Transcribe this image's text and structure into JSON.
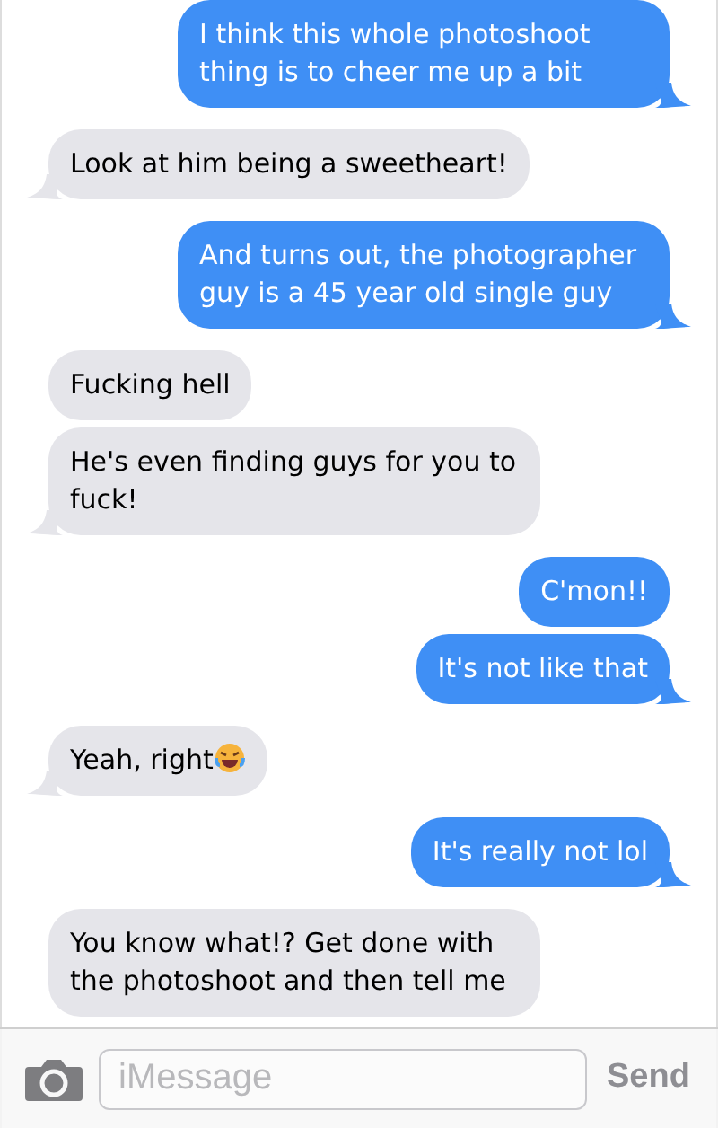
{
  "messages": [
    {
      "kind": "sent",
      "text": "I think this whole photoshoot thing is to cheer me up a bit",
      "tail": true
    },
    {
      "kind": "received",
      "text": "Look at him being a sweetheart!",
      "tail": true
    },
    {
      "kind": "sent",
      "text": "And turns out, the photographer guy is a 45 year old single guy",
      "tail": true
    },
    {
      "kind": "received",
      "text": "Fucking hell",
      "tail": false
    },
    {
      "kind": "received",
      "text": "He's even finding guys for you to fuck!",
      "tail": true
    },
    {
      "kind": "sent",
      "text": "C'mon!!",
      "tail": false
    },
    {
      "kind": "sent",
      "text": "It's not like that",
      "tail": true
    },
    {
      "kind": "received",
      "text": "Yeah, right",
      "emoji": true,
      "tail": true
    },
    {
      "kind": "sent",
      "text": "It's really not lol",
      "tail": true
    },
    {
      "kind": "received",
      "text": "You know what!? Get done with the photoshoot and then tell me",
      "tail": false
    }
  ],
  "composer": {
    "placeholder": "iMessage",
    "send": "Send"
  }
}
